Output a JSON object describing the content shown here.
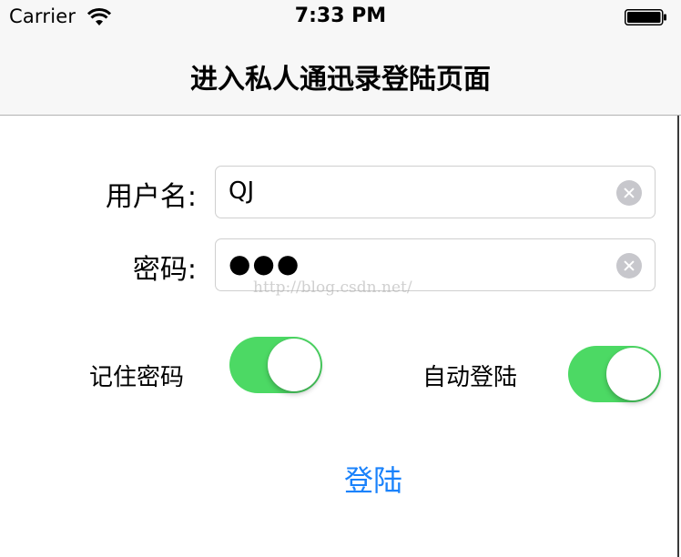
{
  "status_bar": {
    "carrier": "Carrier",
    "time": "7:33 PM",
    "icons": [
      "wifi-icon",
      "battery-icon"
    ]
  },
  "nav": {
    "title": "进入私人通迅录登陆页面"
  },
  "form": {
    "username_label": "用户名:",
    "username_value": "QJ",
    "password_label": "密码:",
    "password_masked": "●●●"
  },
  "options": {
    "remember_label": "记住密码",
    "remember_on": true,
    "autologin_label": "自动登陆",
    "autologin_on": true
  },
  "watermark": "http://blog.csdn.net/",
  "login_button_label": "登陆",
  "colors": {
    "switch_on": "#4cd964",
    "accent": "#1a82fb",
    "clear_button": "#c7c7cc"
  }
}
